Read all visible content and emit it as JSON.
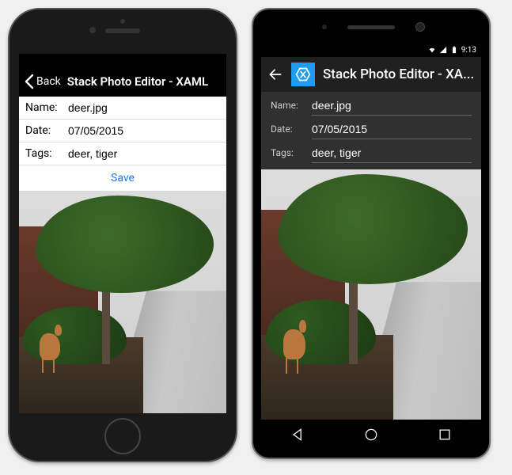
{
  "ios": {
    "back_label": "Back",
    "title": "Stack Photo Editor - XAML",
    "fields": {
      "name_label": "Name:",
      "name_value": "deer.jpg",
      "date_label": "Date:",
      "date_value": "07/05/2015",
      "tags_label": "Tags:",
      "tags_value": "deer, tiger"
    },
    "save_label": "Save"
  },
  "android": {
    "status_time": "9:13",
    "title": "Stack Photo Editor - XA...",
    "fields": {
      "name_label": "Name:",
      "name_value": "deer.jpg",
      "date_label": "Date:",
      "date_value": "07/05/2015",
      "tags_label": "Tags:",
      "tags_value": "deer, tiger"
    }
  }
}
